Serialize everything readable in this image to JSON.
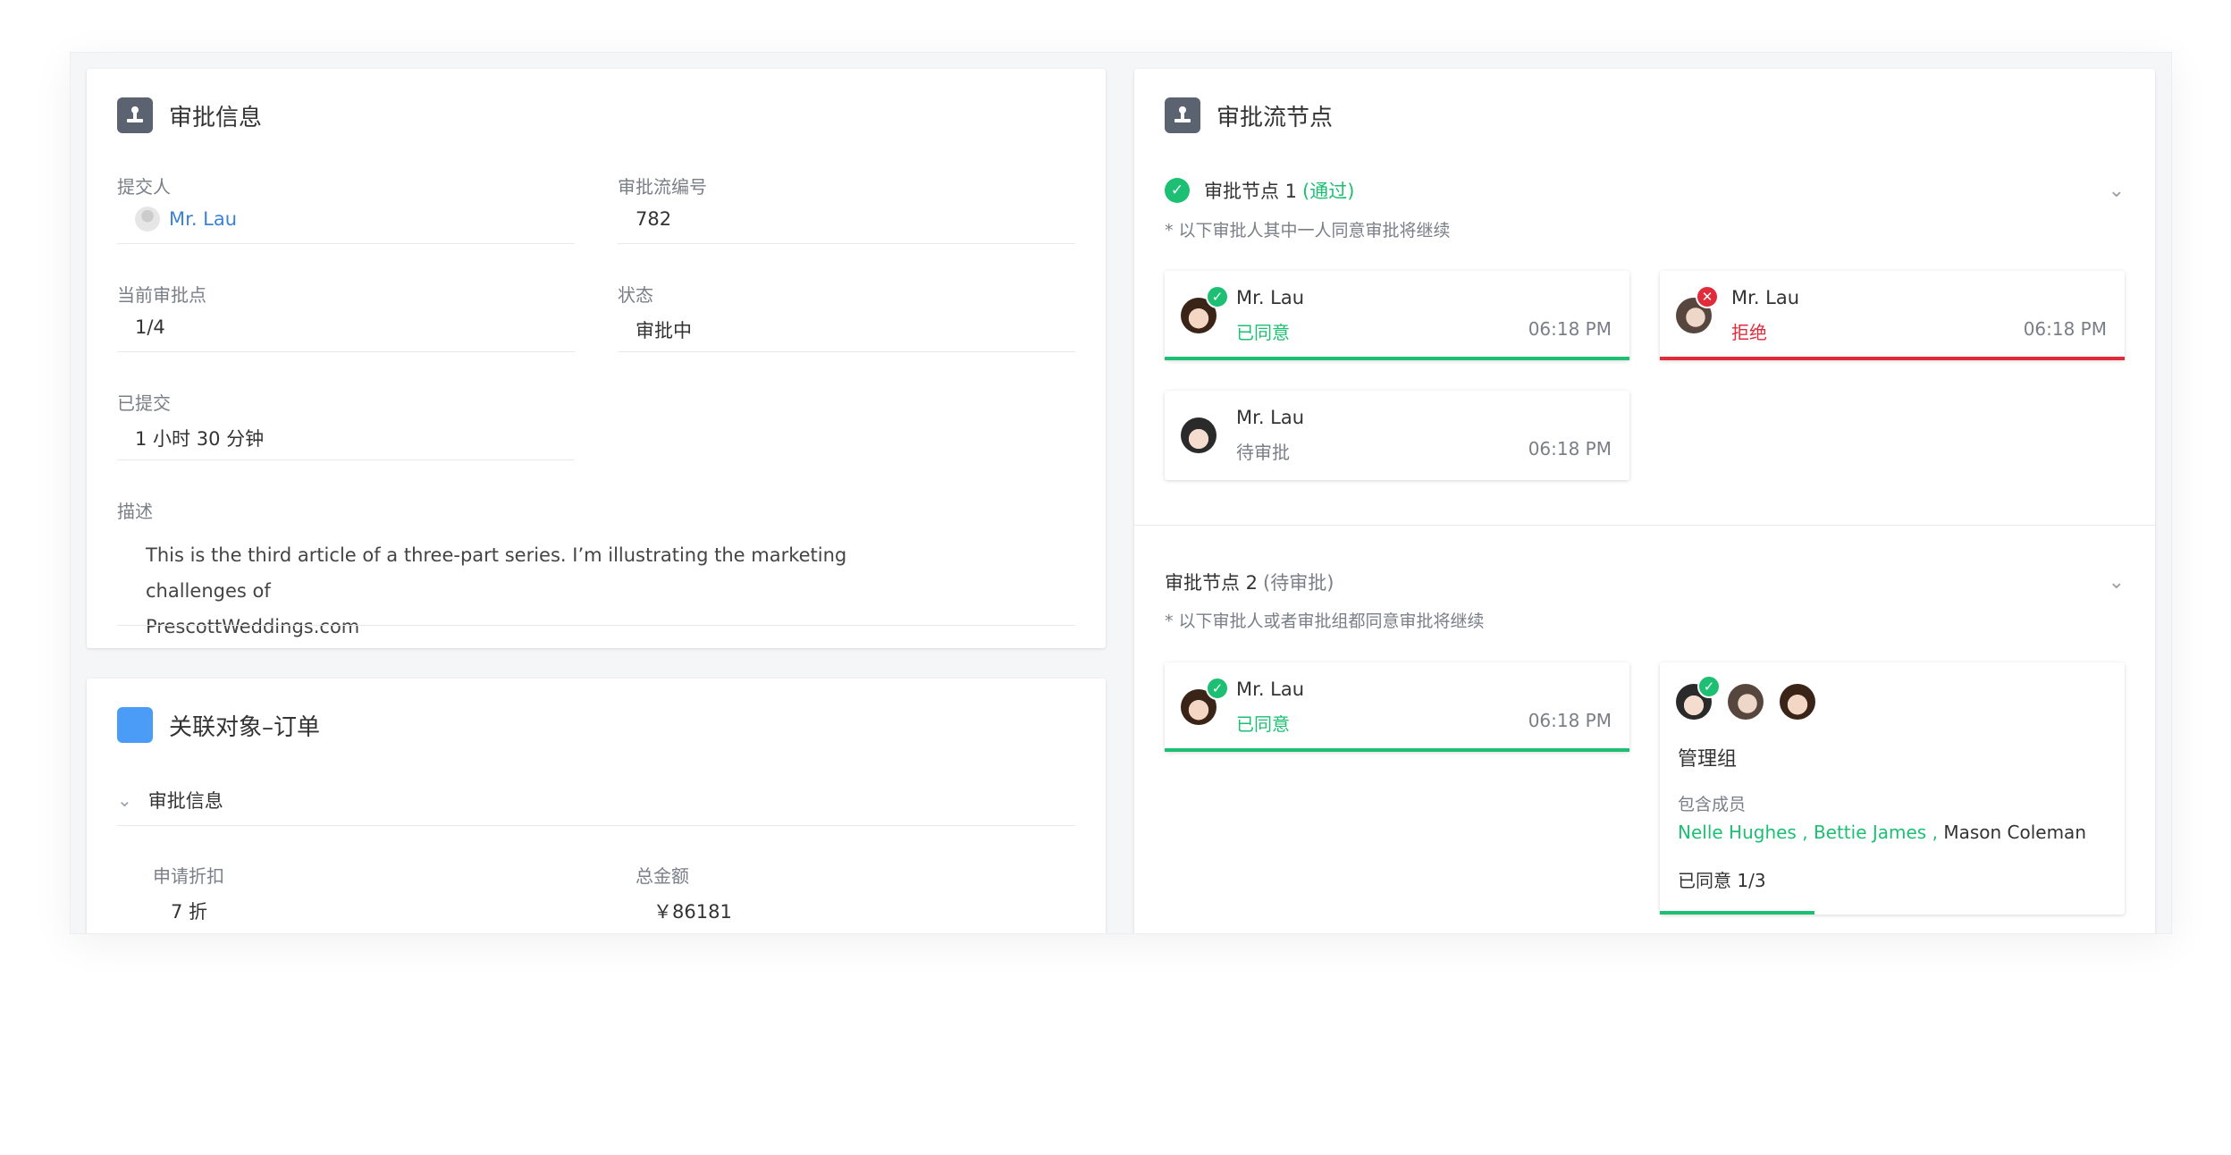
{
  "approval_info": {
    "title": "审批信息",
    "submitter_label": "提交人",
    "submitter_value": "Mr. Lau",
    "flow_no_label": "审批流编号",
    "flow_no_value": "782",
    "current_point_label": "当前审批点",
    "current_point_value": "1/4",
    "status_label": "状态",
    "status_value": "审批中",
    "submitted_label": "已提交",
    "submitted_value": "1 小时 30 分钟",
    "desc_label": "描述",
    "desc_line1": "This is the third article of a three-part series. I’m illustrating the marketing challenges of",
    "desc_line2": "PrescottWeddings.com"
  },
  "related": {
    "title": "关联对象–订单",
    "section_title": "审批信息",
    "discount_label": "申请折扣",
    "discount_value": "7 折",
    "total_label": "总金额",
    "total_value": "￥86181"
  },
  "flow": {
    "title": "审批流节点",
    "node1": {
      "title": "审批节点 1",
      "status": "(通过)",
      "note": "* 以下审批人其中一人同意审批将继续",
      "approvers": [
        {
          "name": "Mr. Lau",
          "state": "已同意",
          "time": "06:18 PM",
          "badge": "✓"
        },
        {
          "name": "Mr. Lau",
          "state": "拒绝",
          "time": "06:18 PM",
          "badge": "✕"
        },
        {
          "name": "Mr. Lau",
          "state": "待审批",
          "time": "06:18 PM"
        }
      ]
    },
    "node2": {
      "title": "审批节点 2",
      "status": "(待审批)",
      "note": "* 以下审批人或者审批组都同意审批将继续",
      "approver": {
        "name": "Mr. Lau",
        "state": "已同意",
        "time": "06:18 PM",
        "badge": "✓"
      },
      "group": {
        "name": "管理组",
        "members_label": "包含成员",
        "member1": "Nelle Hughes",
        "member2": "Bettie James",
        "member3": "Mason Coleman",
        "separator": " , ",
        "agreed": "已同意 1/3",
        "progress": 0.333,
        "badge": "✓"
      }
    },
    "chevron": "⌄",
    "check": "✓"
  },
  "colors": {
    "green": "#1dbf73",
    "red": "#e22b3a",
    "link_blue": "#3a83d6",
    "icon_grey": "#5b6270",
    "icon_blue": "#4a9cf6"
  }
}
